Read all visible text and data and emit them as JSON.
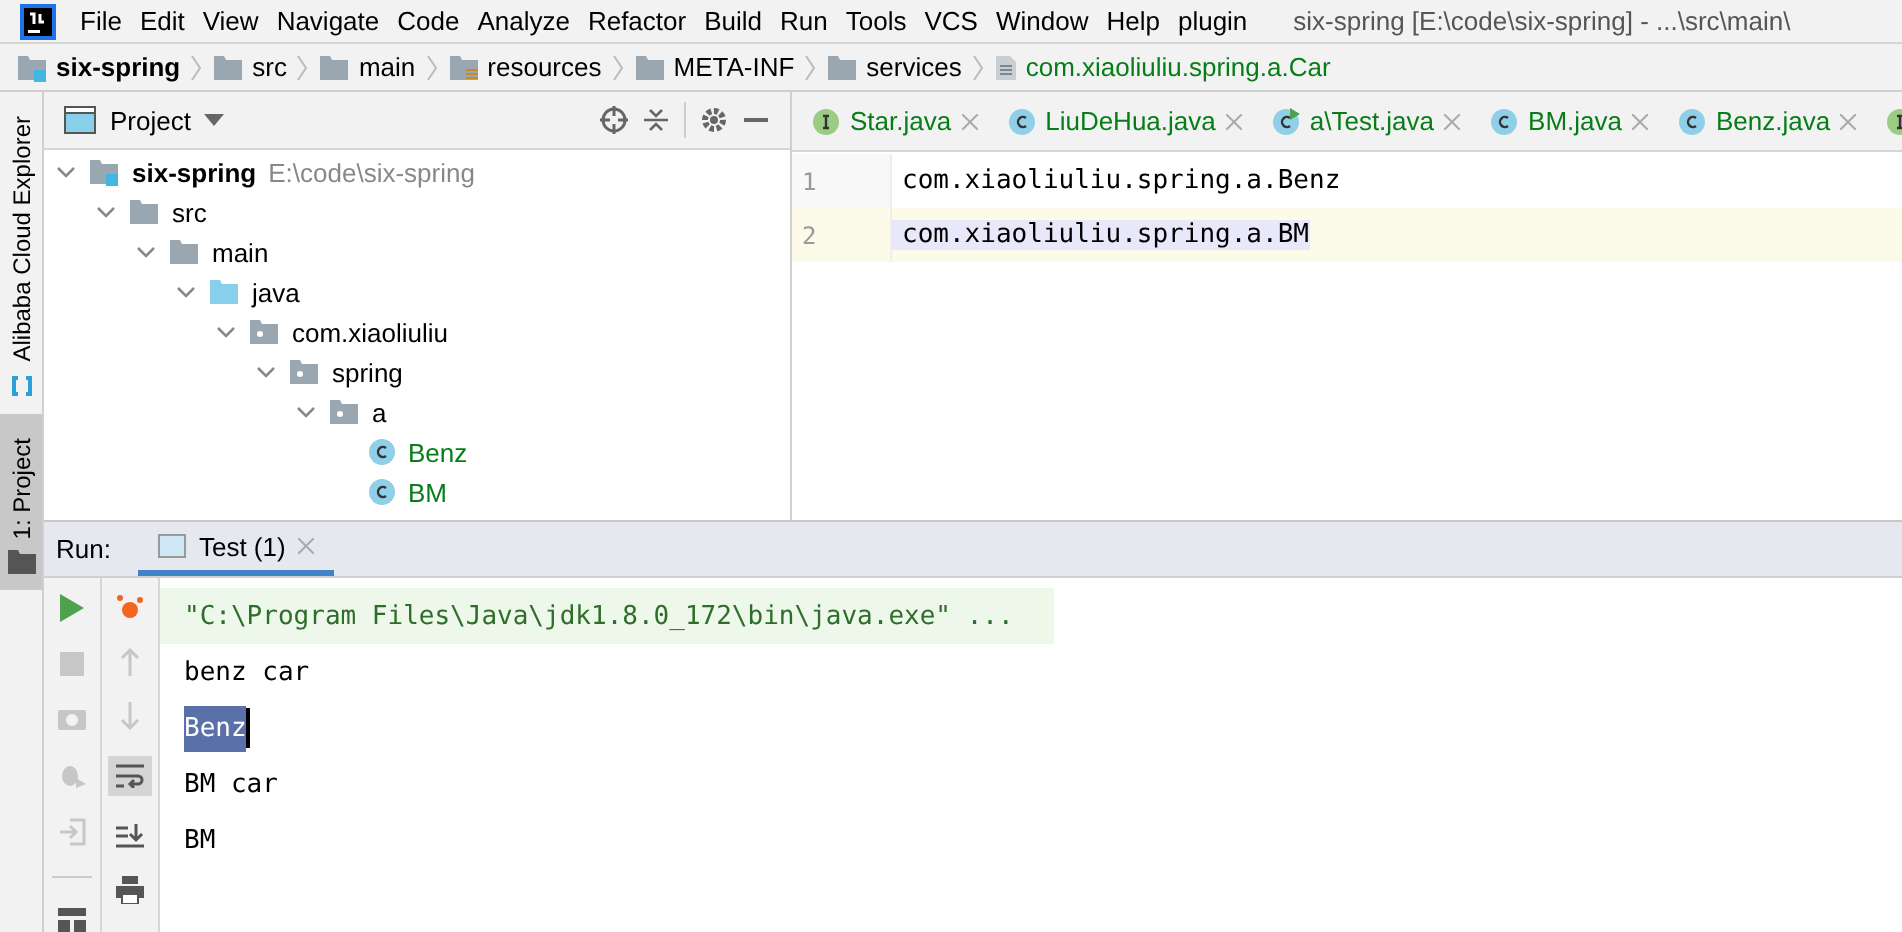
{
  "menu": [
    "File",
    "Edit",
    "View",
    "Navigate",
    "Code",
    "Analyze",
    "Refactor",
    "Build",
    "Run",
    "Tools",
    "VCS",
    "Window",
    "Help",
    "plugin"
  ],
  "window": {
    "title": "six-spring [E:\\code\\six-spring] - ...\\src\\main\\"
  },
  "breadcrumb": [
    {
      "label": "six-spring",
      "kind": "module"
    },
    {
      "label": "src",
      "kind": "folder"
    },
    {
      "label": "main",
      "kind": "folder"
    },
    {
      "label": "resources",
      "kind": "resources"
    },
    {
      "label": "META-INF",
      "kind": "folder"
    },
    {
      "label": "services",
      "kind": "folder"
    },
    {
      "label": "com.xiaoliuliu.spring.a.Car",
      "kind": "file"
    }
  ],
  "side_stripe": [
    {
      "label": "Alibaba Cloud Explorer",
      "selected": false
    },
    {
      "label": "1: Project",
      "selected": true
    }
  ],
  "project_panel": {
    "title": "Project",
    "tree": [
      {
        "label": "six-spring",
        "path": "E:\\code\\six-spring",
        "kind": "module",
        "expanded": true,
        "children": [
          {
            "label": "src",
            "kind": "folder",
            "expanded": true,
            "children": [
              {
                "label": "main",
                "kind": "folder",
                "expanded": true,
                "children": [
                  {
                    "label": "java",
                    "kind": "source",
                    "expanded": true,
                    "children": [
                      {
                        "label": "com.xiaoliuliu",
                        "kind": "package",
                        "expanded": true,
                        "children": [
                          {
                            "label": "spring",
                            "kind": "package",
                            "expanded": true,
                            "children": [
                              {
                                "label": "a",
                                "kind": "package",
                                "expanded": true,
                                "children": [
                                  {
                                    "label": "Benz",
                                    "kind": "class"
                                  },
                                  {
                                    "label": "BM",
                                    "kind": "class"
                                  }
                                ]
                              }
                            ]
                          }
                        ]
                      }
                    ]
                  }
                ]
              }
            ]
          }
        ]
      }
    ]
  },
  "editor_tabs": [
    {
      "label": "Star.java",
      "kind": "interface",
      "selected": false
    },
    {
      "label": "LiuDeHua.java",
      "kind": "class",
      "selected": false
    },
    {
      "label": "a\\Test.java",
      "kind": "runnable",
      "selected": false
    },
    {
      "label": "BM.java",
      "kind": "class",
      "selected": false
    },
    {
      "label": "Benz.java",
      "kind": "class",
      "selected": false
    },
    {
      "kind": "interface",
      "selected": false
    }
  ],
  "editor_lines": [
    {
      "number": "1",
      "text": "com.xiaoliuliu.spring.a.Benz",
      "current": false
    },
    {
      "number": "2",
      "text": "com.xiaoliuliu.spring.a.BM",
      "current": true
    }
  ],
  "run_panel": {
    "label": "Run:",
    "tabs": [
      {
        "label": "Test (1)",
        "selected": true
      }
    ],
    "console": [
      {
        "text": "\"C:\\Program Files\\Java\\jdk1.8.0_172\\bin\\java.exe\" ...",
        "kind": "command",
        "selected": false
      },
      {
        "text": "benz car",
        "kind": "output",
        "selected": false
      },
      {
        "text": "Benz",
        "kind": "output",
        "selected": true
      },
      {
        "text": "BM car",
        "kind": "output",
        "selected": false
      },
      {
        "text": "BM",
        "kind": "output",
        "selected": false
      }
    ]
  }
}
